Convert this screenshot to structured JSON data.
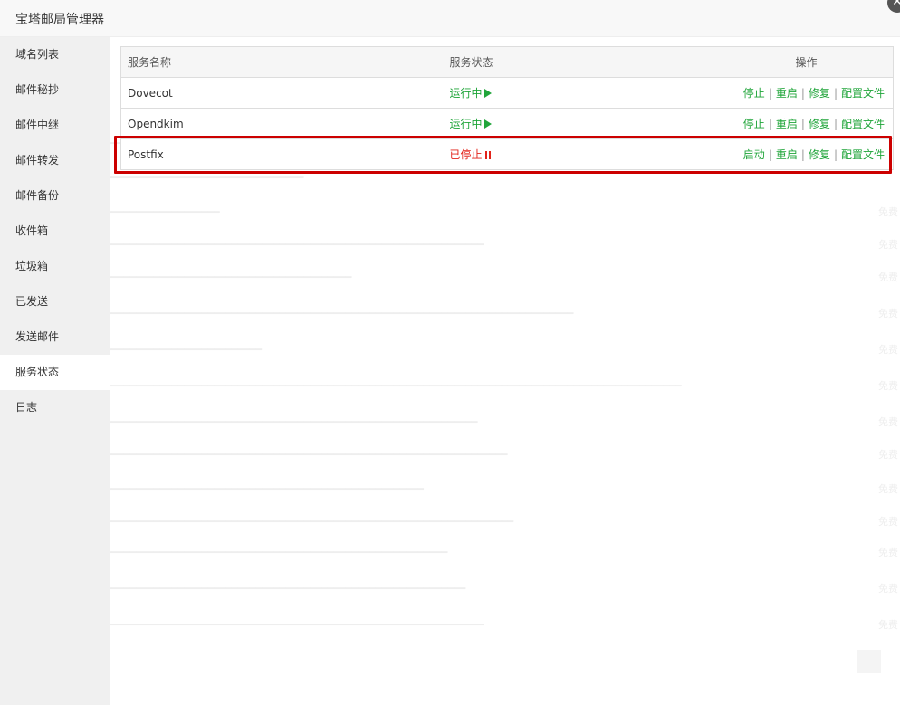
{
  "dialog": {
    "title": "宝塔邮局管理器",
    "close_glyph": "✕"
  },
  "sidebar": {
    "items": [
      {
        "label": "域名列表"
      },
      {
        "label": "邮件秘抄"
      },
      {
        "label": "邮件中继"
      },
      {
        "label": "邮件转发"
      },
      {
        "label": "邮件备份"
      },
      {
        "label": "收件箱"
      },
      {
        "label": "垃圾箱"
      },
      {
        "label": "已发送"
      },
      {
        "label": "发送邮件"
      },
      {
        "label": "服务状态"
      },
      {
        "label": "日志"
      }
    ],
    "active": "服务状态"
  },
  "table": {
    "headers": {
      "name": "服务名称",
      "status": "服务状态",
      "actions": "操作"
    },
    "rows": [
      {
        "name": "Dovecot",
        "status": "运行中",
        "state": "running",
        "actions": [
          "停止",
          "重启",
          "修复",
          "配置文件"
        ]
      },
      {
        "name": "Opendkim",
        "status": "运行中",
        "state": "running",
        "actions": [
          "停止",
          "重启",
          "修复",
          "配置文件"
        ]
      },
      {
        "name": "Postfix",
        "status": "已停止",
        "state": "stopped",
        "actions": [
          "启动",
          "重启",
          "修复",
          "配置文件"
        ]
      }
    ]
  },
  "background": {
    "link_label": "免费"
  },
  "colors": {
    "running": "#20a53a",
    "stopped": "#e2231a",
    "highlight": "#cc0000",
    "sidebar_bg": "#f0f0f0"
  }
}
